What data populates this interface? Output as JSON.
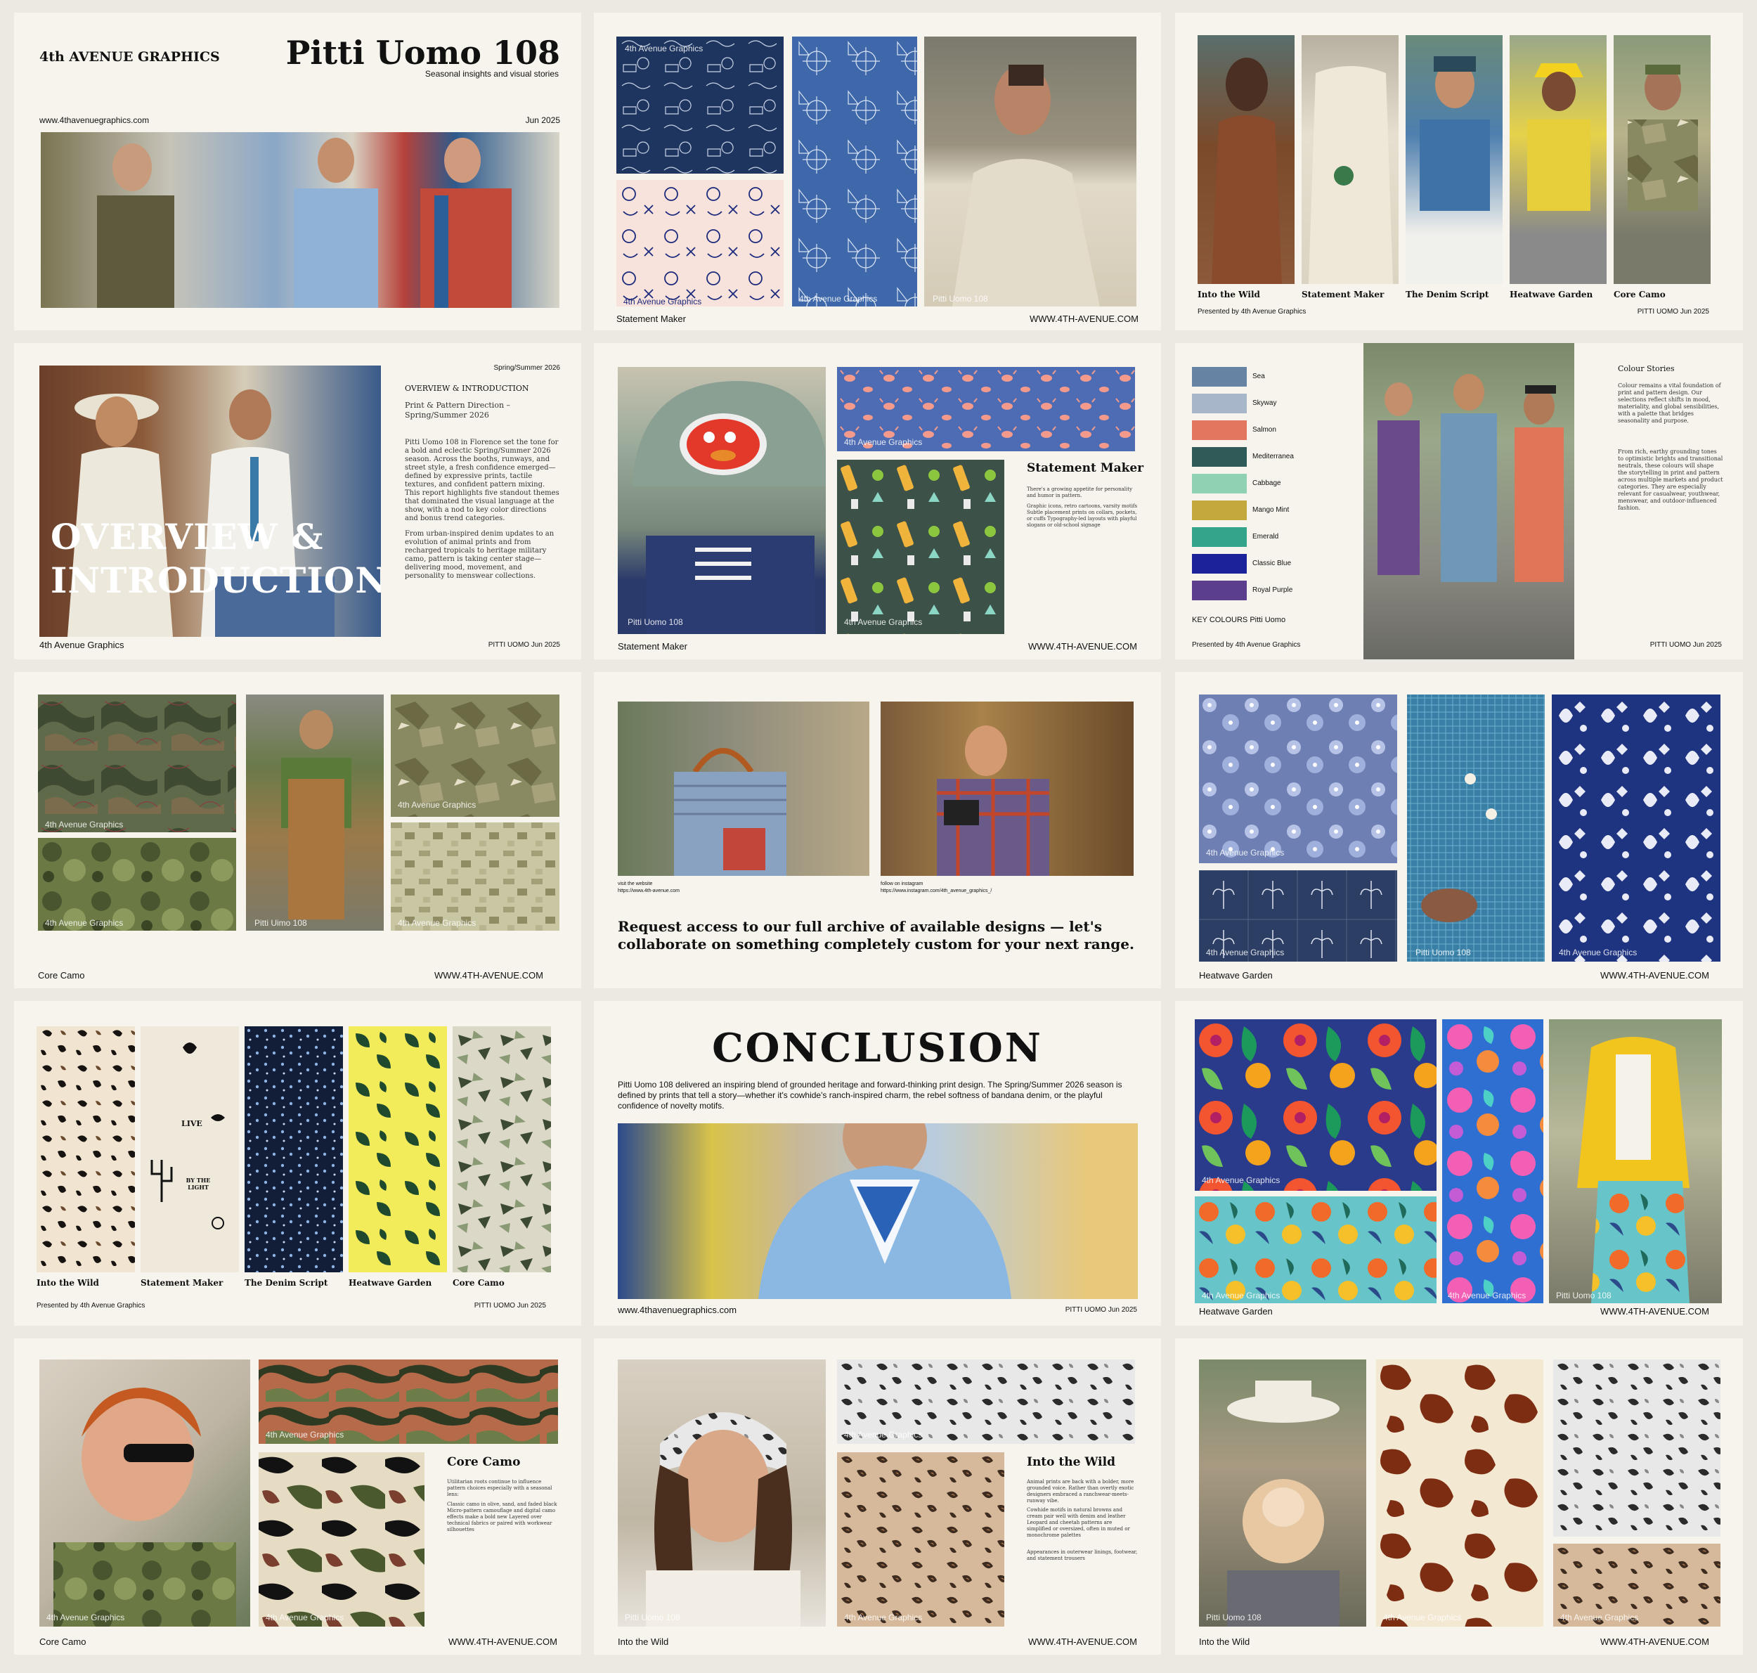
{
  "s1": {
    "brand": "4th AVENUE GRAPHICS",
    "title": "Pitti Uomo 108",
    "subtitle": "Seasonal insights and visual stories",
    "url": "www.4thavenuegraphics.com",
    "date": "Jun 2025"
  },
  "s2": {
    "wm1": "4th Avenue Graphics",
    "wm2": "4th Avenue Graphics",
    "wm3": "4th Avenue Graphics",
    "wm4": "Pitti Uomo 108",
    "caption": "Statement Maker",
    "site": "WWW.4TH-AVENUE.COM"
  },
  "s3": {
    "labels": [
      "Into the Wild",
      "Statement Maker",
      "The Denim Script",
      "Heatwave Garden",
      "Core Camo"
    ],
    "presented": "Presented by 4th Avenue Graphics",
    "date": "PITTI UOMO Jun 2025"
  },
  "s4": {
    "season": "Spring/Summer 2026",
    "heading": "OVERVIEW & INTRODUCTION",
    "sub": "Print & Pattern Direction – Spring/Summer 2026",
    "p1": "Pitti Uomo 108 in Florence set the tone for a bold and eclectic Spring/Summer 2026 season. Across the booths, runways, and street style, a fresh confidence emerged—defined by expressive prints, tactile textures, and confident pattern mixing. This report highlights five standout themes that dominated the visual language at the show, with a nod to key color directions and bonus trend categories.",
    "p2": "From urban-inspired denim updates to an evolution of animal prints and from recharged tropicals to heritage military camo, pattern is taking center stage—delivering mood, movement, and personality to menswear collections.",
    "big1": "OVERVIEW &",
    "big2": "INTRODUCTION",
    "footer": "4th Avenue Graphics",
    "date": "PITTI UOMO Jun 2025"
  },
  "s5": {
    "wm1": "4th Avenue Graphics",
    "wm2": "4th Avenue Graphics",
    "wm3": "Pitti Uomo 108",
    "title": "Statement Maker",
    "p1": "There's a growing appetite for personality and humor in pattern.",
    "p2": "Graphic icons, retro cartoons, varsity motifs Subtle placement prints on collars, pockets, or cuffs Typography-led layouts with playful slogans or old-school signage",
    "caption": "Statement Maker",
    "site": "WWW.4TH-AVENUE.COM"
  },
  "s6": {
    "colours": [
      {
        "name": "Sea",
        "hex": "#6683a3"
      },
      {
        "name": "Skyway",
        "hex": "#a7b6c8"
      },
      {
        "name": "Salmon",
        "hex": "#e2765e"
      },
      {
        "name": "Mediterranea",
        "hex": "#2f5a57"
      },
      {
        "name": "Cabbage",
        "hex": "#8fd1b1"
      },
      {
        "name": "Mango Mint",
        "hex": "#c3a93d"
      },
      {
        "name": "Emerald",
        "hex": "#34a58a"
      },
      {
        "name": "Classic Blue",
        "hex": "#1a239a"
      },
      {
        "name": "Royal Purple",
        "hex": "#5b3f8e"
      }
    ],
    "key": "KEY COLOURS Pitti Uomo",
    "presented": "Presented by 4th Avenue Graphics",
    "title": "Colour Stories",
    "p1": "Colour remains a vital foundation of print and pattern design. Our selections reflect shifts in mood, materiality, and global sensibilities, with a palette that bridges seasonality and purpose.",
    "p2": "From rich, earthy grounding tones to optimistic brights and transitional neutrals, these colours will shape the storytelling in print and pattern across multiple markets and product categories. They are especially relevant for casualwear, youthwear, menswear, and outdoor-influenced fashion.",
    "date": "PITTI UOMO Jun 2025"
  },
  "s7": {
    "wm1": "4th Avenue Graphics",
    "wm2": "4th Avenue Graphics",
    "wm3": "Pitti Uimo 108",
    "wm4": "4th Avenue Graphics",
    "wm5": "4th Avenue Graphics",
    "caption": "Core Camo",
    "site": "WWW.4TH-AVENUE.COM"
  },
  "s8": {
    "cap1a": "visit the website",
    "cap1b": "https://www.4th-avenue.com",
    "cap2a": "follow on instagram",
    "cap2b": "https://www.instagram.com/4th_avenue_graphics_/",
    "cta": "Request access to our full archive of available designs — let's collaborate on something completely custom for your next range."
  },
  "s9": {
    "wm1": "4th Avenue Graphics",
    "wm2": "4th Avenue Graphics",
    "wm3": "Pitti Uomo 108",
    "wm4": "4th Avenue Graphics",
    "caption": "Heatwave Garden",
    "site": "WWW.4TH-AVENUE.COM"
  },
  "s10": {
    "labels": [
      "Into the Wild",
      "Statement Maker",
      "The Denim Script",
      "Heatwave Garden",
      "Core Camo"
    ],
    "presented": "Presented by 4th Avenue Graphics",
    "date": "PITTI UOMO Jun 2025",
    "card1": "LIVE",
    "card2": "BY THE LIGHT"
  },
  "s11": {
    "title": "CONCLUSION",
    "text": "Pitti Uomo 108 delivered an inspiring blend of grounded heritage and forward-thinking print design. The Spring/Summer 2026 season is defined by prints that tell a story—whether it's cowhide's ranch-inspired charm, the rebel softness of bandana denim, or the playful confidence of novelty motifs.",
    "url": "www.4thavenuegraphics.com",
    "date": "PITTI UOMO Jun 2025"
  },
  "s12": {
    "wm1": "4th Avenue Graphics",
    "wm2": "4th Avenue Graphics",
    "wm3": "4th Avenue Graphics",
    "wm4": "Pitti Uomo 108",
    "caption": "Heatwave Garden",
    "site": "WWW.4TH-AVENUE.COM"
  },
  "s13": {
    "wm1": "4th Avenue Graphics",
    "wm2": "4th Avenue Graphics",
    "wm3": "4th Avenue Graphics",
    "title": "Core Camo",
    "p1": "Utilitarian roots continue to influence pattern choices especially with a seasonal lens:",
    "p2": "Classic camo in olive, sand, and faded black Micro-pattern camouflage and digital camo effects make a bold new Layered over technical fabrics or paired with workwear silhouettes",
    "caption": "Core Camo",
    "site": "WWW.4TH-AVENUE.COM"
  },
  "s14": {
    "wm1": "4th Avenue Graphics",
    "wm2": "4th Avenue Graphics",
    "wm3": "Pitti Uomo 108",
    "title": "Into the Wild",
    "p1": "Animal prints are back with a bolder, more grounded voice. Rather than overtly exotic designers embraced a ranchwear-meets-runway vibe.",
    "p2": "Cowhide motifs in natural browns and cream pair well with denim and leather Leopard and cheetah patterns are simplified or oversized, often in muted or monochrome palettes",
    "p3": "Appearances in outerwear linings, footwear, and statement trousers",
    "caption": "Into the Wild",
    "site": "WWW.4TH-AVENUE.COM"
  },
  "s15": {
    "wm1": "Pitti Uomo 108",
    "wm2": "4th Avenue Graphics",
    "wm3": "4th Avenue Graphics",
    "wm4": "4th Avenue Graphics",
    "caption": "Into the Wild",
    "site": "WWW.4TH-AVENUE.COM"
  }
}
